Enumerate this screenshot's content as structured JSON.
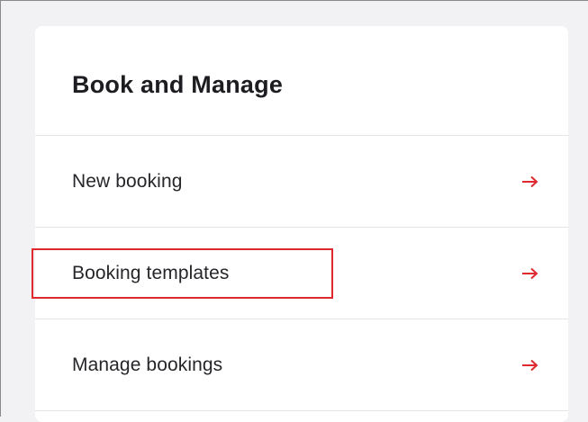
{
  "card": {
    "title": "Book and Manage"
  },
  "menu": {
    "items": [
      {
        "label": "New booking",
        "icon": "arrow-right-icon",
        "highlighted": false
      },
      {
        "label": "Booking templates",
        "icon": "arrow-right-icon",
        "highlighted": true
      },
      {
        "label": "Manage bookings",
        "icon": "arrow-right-icon",
        "highlighted": false
      }
    ]
  },
  "colors": {
    "accent": "#e0292f",
    "background": "#f2f2f4",
    "card": "#ffffff",
    "text": "#1d1d21",
    "divider": "#e4e4e8"
  }
}
